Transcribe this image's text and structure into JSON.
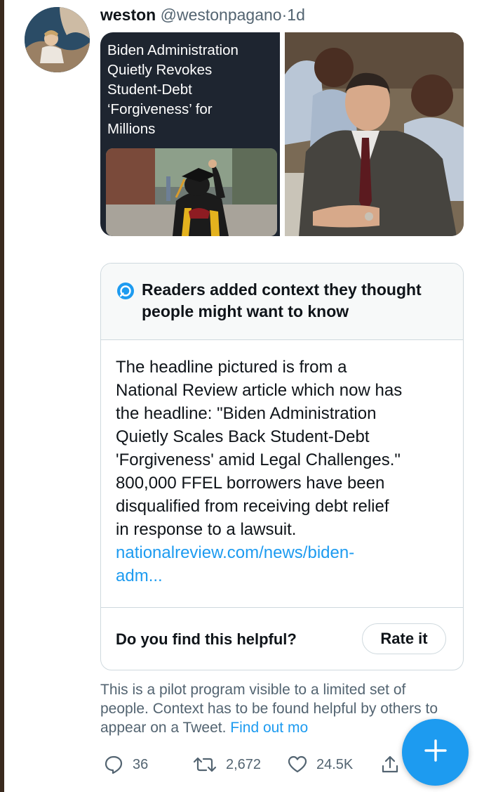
{
  "tweet": {
    "author_name": "weston",
    "author_handle": "@westonpagano",
    "separator": "·",
    "time": "1d"
  },
  "media": {
    "headline": "Biden Administration\nQuietly Revokes\nStudent-Debt\n‘Forgiveness’ for\nMillions"
  },
  "note": {
    "title": "Readers added context they thought\npeople might want to know",
    "body": "The headline pictured is from a\nNational Review article which now has\nthe headline: \"Biden Administration\nQuietly Scales Back Student-Debt\n'Forgiveness' amid Legal Challenges.\"\n800,000 FFEL borrowers have been\ndisqualified from receiving debt relief\nin response to a lawsuit.",
    "link": "nationalreview.com/news/biden-\nadm...",
    "helpful_question": "Do you find this helpful?",
    "rate_label": "Rate it"
  },
  "pilot": {
    "text": "This is a pilot program visible to a limited set of people. Context has to be found helpful by others to appear on a Tweet.",
    "link": "Find out mo"
  },
  "actions": {
    "replies": "36",
    "retweets": "2,672",
    "likes": "24.5K"
  },
  "colors": {
    "accent": "#1d9bf0",
    "secondary_text": "#536471",
    "note_header_bg": "#f7f9f9",
    "border": "#cfd9de"
  },
  "icons": {
    "note": "birdwatch-eye-icon",
    "reply": "reply-icon",
    "retweet": "retweet-icon",
    "like": "heart-icon",
    "share": "share-icon",
    "compose": "plus-icon"
  }
}
